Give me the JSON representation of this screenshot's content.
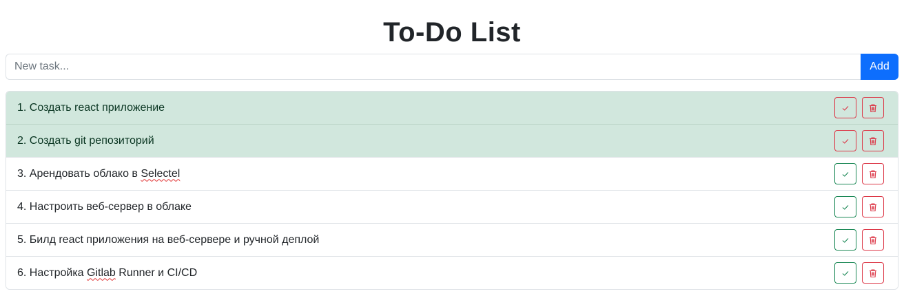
{
  "header": {
    "title": "To-Do List"
  },
  "new_task": {
    "placeholder": "New task...",
    "value": "",
    "add_label": "Add"
  },
  "colors": {
    "primary": "#0d6efd",
    "success": "#198754",
    "danger": "#dc3545",
    "completed_bg": "#d1e7dd"
  },
  "tasks": [
    {
      "number": "1.",
      "text": "Создать react приложение",
      "completed": true
    },
    {
      "number": "2.",
      "text": "Создать git репозиторий",
      "completed": true
    },
    {
      "number": "3.",
      "text_pre": "Арендовать облако в ",
      "text_flag": "Selectel",
      "text_post": "",
      "completed": false
    },
    {
      "number": "4.",
      "text": "Настроить веб-сервер в облаке",
      "completed": false
    },
    {
      "number": "5.",
      "text": "Билд react приложения на веб-сервере и ручной деплой",
      "completed": false
    },
    {
      "number": "6.",
      "text_pre": "Настройка ",
      "text_flag": "Gitlab",
      "text_post": " Runner и CI/CD",
      "completed": false
    }
  ],
  "icons": {
    "complete": "check-icon",
    "delete": "trash-icon"
  }
}
